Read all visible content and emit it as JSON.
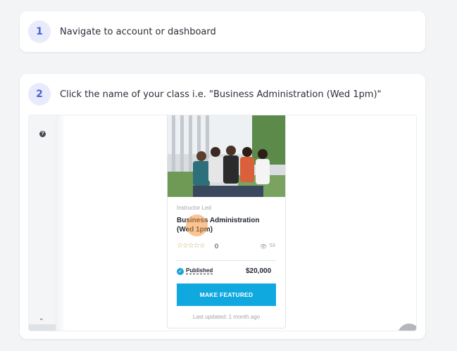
{
  "steps": [
    {
      "number": "1",
      "text": "Navigate to account or dashboard"
    },
    {
      "number": "2",
      "text": "Click the name of your class i.e. \"Business Administration (Wed 1pm)\""
    }
  ],
  "course_card": {
    "type_label": "Instructor Led",
    "title": "Business Administration (Wed 1pm)",
    "stars": "☆☆☆☆☆",
    "rating": "0",
    "views": "53",
    "status": "Published",
    "price": "$20,000",
    "button_label": "MAKE FEATURED",
    "updated": "Last updated: 1 month ago"
  },
  "sidebar": {
    "help_icon": "?",
    "scroll_icon": "⌄"
  },
  "icons": {
    "help": "question-circle-icon",
    "scroll": "chevron-down-icon",
    "eye": "eye-icon",
    "check": "check-circle-icon",
    "zoom_in": "zoom-in-icon",
    "zoom_out": "zoom-out-icon"
  },
  "colors": {
    "step_badge_bg": "#e8ebfb",
    "step_badge_text": "#4f5fd6",
    "button": "#10a9df",
    "highlight": "#f5963c"
  }
}
